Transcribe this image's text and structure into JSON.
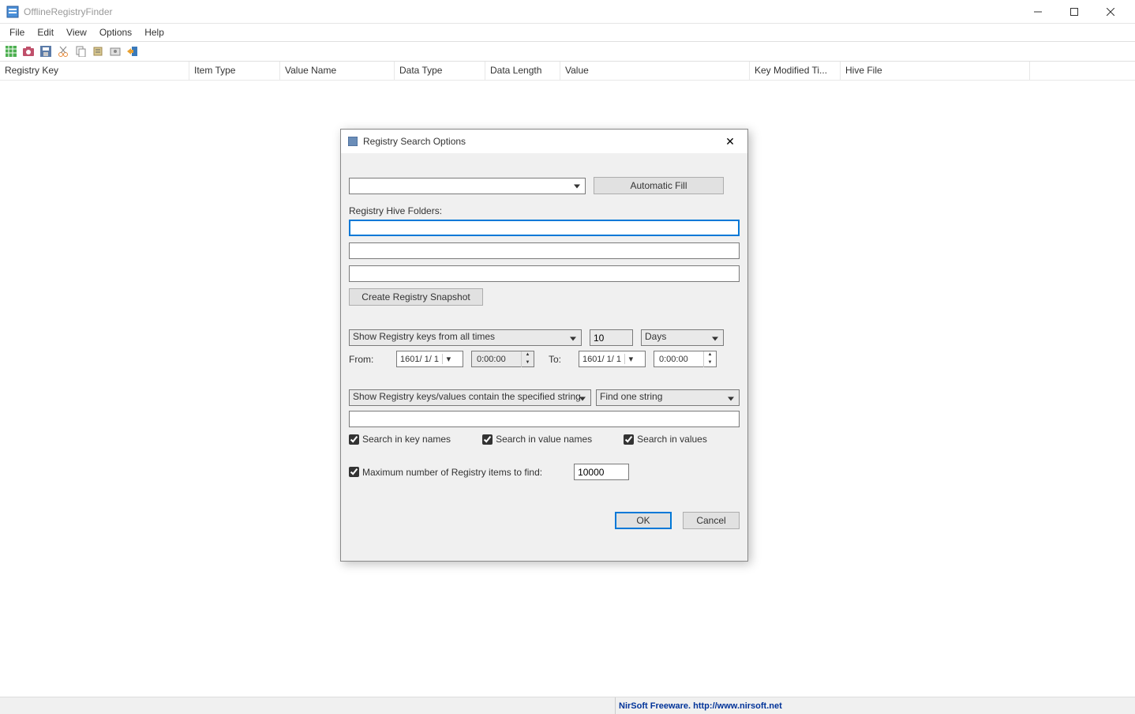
{
  "app": {
    "title": "OfflineRegistryFinder"
  },
  "menu": {
    "file": "File",
    "edit": "Edit",
    "view": "View",
    "options": "Options",
    "help": "Help"
  },
  "columns": {
    "c0": "Registry Key",
    "c1": "Item Type",
    "c2": "Value Name",
    "c3": "Data Type",
    "c4": "Data Length",
    "c5": "Value",
    "c6": "Key Modified Ti...",
    "c7": "Hive File"
  },
  "dialog": {
    "title": "Registry Search Options",
    "auto_fill": "Automatic Fill",
    "hive_folders_label": "Registry Hive Folders:",
    "hive1": "",
    "hive2": "",
    "hive3": "",
    "snapshot_btn": "Create Registry Snapshot",
    "time_filter": "Show Registry keys from all times",
    "time_num": "10",
    "time_unit": "Days",
    "from_label": "From:",
    "from_date": "1601/ 1/ 1",
    "from_time": "0:00:00",
    "to_label": "To:",
    "to_date": "1601/ 1/ 1",
    "to_time": "0:00:00",
    "contain_filter": "Show Registry keys/values contain the specified string",
    "find_mode": "Find one string",
    "search_string": "",
    "chk_keynames": "Search in key names",
    "chk_valuenames": "Search in value names",
    "chk_values": "Search in values",
    "chk_max": "Maximum number of Registry items to find:",
    "max_value": "10000",
    "ok": "OK",
    "cancel": "Cancel"
  },
  "status": {
    "credit": "NirSoft Freeware.  http://www.nirsoft.net"
  }
}
